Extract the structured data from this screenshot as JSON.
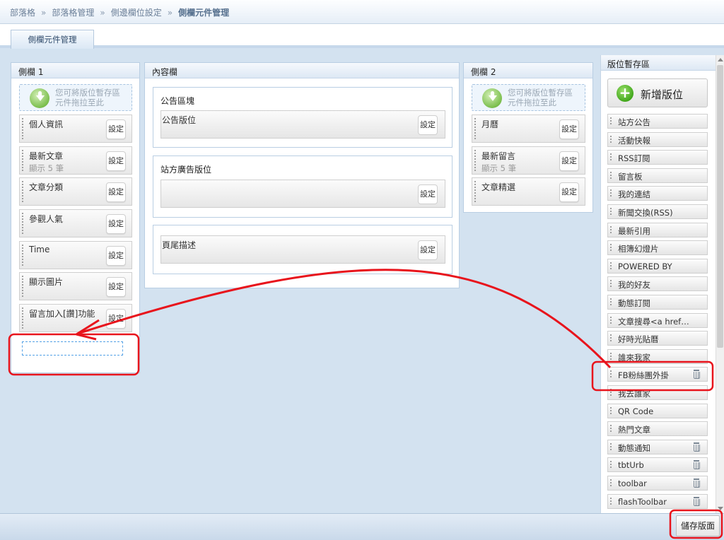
{
  "breadcrumb": {
    "items": [
      "部落格",
      "部落格管理",
      "側邊欄位設定"
    ],
    "current": "側欄元件管理",
    "separator": "»"
  },
  "tab": {
    "label": "側欄元件管理"
  },
  "sidebar1": {
    "title": "側欄 1",
    "drop_hint_line1": "您可將版位暫存區",
    "drop_hint_line2": "元件拖拉至此",
    "widgets": [
      {
        "name": "個人資訊",
        "sub": "",
        "setting": "設定"
      },
      {
        "name": "最新文章",
        "sub": "顯示 5 筆",
        "setting": "設定"
      },
      {
        "name": "文章分類",
        "sub": "",
        "setting": "設定"
      },
      {
        "name": "參觀人氣",
        "sub": "",
        "setting": "設定"
      },
      {
        "name": "Time",
        "sub": "",
        "setting": "設定"
      },
      {
        "name": "顯示圖片",
        "sub": "",
        "setting": "設定"
      },
      {
        "name": "留言加入[讚]功能",
        "sub": "",
        "setting": "設定"
      }
    ]
  },
  "content": {
    "title": "內容欄",
    "sections": [
      {
        "title": "公告區塊",
        "widget": "公告版位",
        "setting": "設定"
      },
      {
        "title": "站方廣告版位",
        "widget": "",
        "setting": "設定"
      },
      {
        "title": "",
        "widget": "頁尾描述",
        "setting": "設定"
      }
    ]
  },
  "sidebar2": {
    "title": "側欄 2",
    "drop_hint_line1": "您可將版位暫存區",
    "drop_hint_line2": "元件拖拉至此",
    "widgets": [
      {
        "name": "月曆",
        "sub": "",
        "setting": "設定"
      },
      {
        "name": "最新留言",
        "sub": "顯示 5 筆",
        "setting": "設定"
      },
      {
        "name": "文章精選",
        "sub": "",
        "setting": "設定"
      }
    ]
  },
  "storage": {
    "title": "版位暫存區",
    "new_button": "新增版位",
    "items": [
      {
        "name": "站方公告",
        "deletable": false
      },
      {
        "name": "活動快報",
        "deletable": false
      },
      {
        "name": "RSS訂閱",
        "deletable": false
      },
      {
        "name": "留言板",
        "deletable": false
      },
      {
        "name": "我的連結",
        "deletable": false
      },
      {
        "name": "新聞交換(RSS)",
        "deletable": false
      },
      {
        "name": "最新引用",
        "deletable": false
      },
      {
        "name": "相簿幻燈片",
        "deletable": false
      },
      {
        "name": "POWERED BY",
        "deletable": false
      },
      {
        "name": "我的好友",
        "deletable": false
      },
      {
        "name": "動態訂閱",
        "deletable": false
      },
      {
        "name": "文章搜尋<a href…",
        "deletable": false
      },
      {
        "name": "好時光貼曆",
        "deletable": false
      },
      {
        "name": "誰來我家",
        "deletable": false
      },
      {
        "name": "FB粉絲團外掛",
        "deletable": true
      },
      {
        "name": "我去誰家",
        "deletable": false
      },
      {
        "name": "QR Code",
        "deletable": false
      },
      {
        "name": "熱門文章",
        "deletable": false
      },
      {
        "name": "動態通知",
        "deletable": true
      },
      {
        "name": "tbtUrb",
        "deletable": true
      },
      {
        "name": "toolbar",
        "deletable": true
      },
      {
        "name": "flashToolbar",
        "deletable": true
      }
    ]
  },
  "footer": {
    "save_button": "儲存版面"
  },
  "colors": {
    "annotation": "#e8141c",
    "placeholder_border": "#53a1e6",
    "accent_green": "#3da417"
  }
}
